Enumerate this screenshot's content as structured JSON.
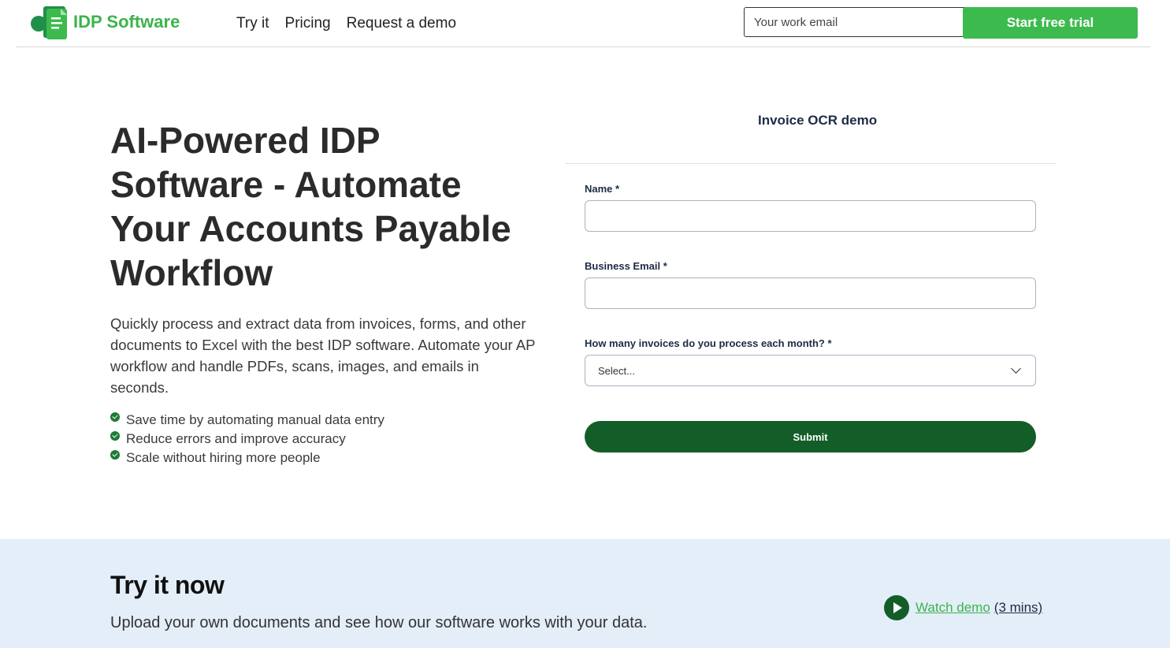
{
  "header": {
    "brand": "IDP Software",
    "logo_icon": "document-logo-icon",
    "nav": [
      "Try it",
      "Pricing",
      "Request a demo"
    ],
    "email_placeholder": "Your work email",
    "trial_button": "Start free trial"
  },
  "hero": {
    "title": "AI-Powered IDP Software - Automate Your Accounts Payable Workflow",
    "description": "Quickly process and extract data from invoices, forms, and other documents to Excel with the best IDP software. Automate your AP workflow and handle PDFs, scans, images, and emails in seconds.",
    "bullets": [
      "Save time by automating manual data entry",
      "Reduce errors and improve accuracy",
      "Scale without hiring more people"
    ]
  },
  "form": {
    "title": "Invoice OCR demo",
    "name_label": "Name *",
    "email_label": "Business Email *",
    "invoices_label": "How many invoices do you process each month? *",
    "select_placeholder": "Select...",
    "submit": "Submit"
  },
  "try_section": {
    "title": "Try it now",
    "subtitle": "Upload your own documents and see how our software works with your data.",
    "watch_link": "Watch demo",
    "watch_duration": "(3 mins)"
  },
  "colors": {
    "brand_green": "#3cb44b",
    "dark_green": "#135e28",
    "bottom_bg": "#e3eef9"
  }
}
